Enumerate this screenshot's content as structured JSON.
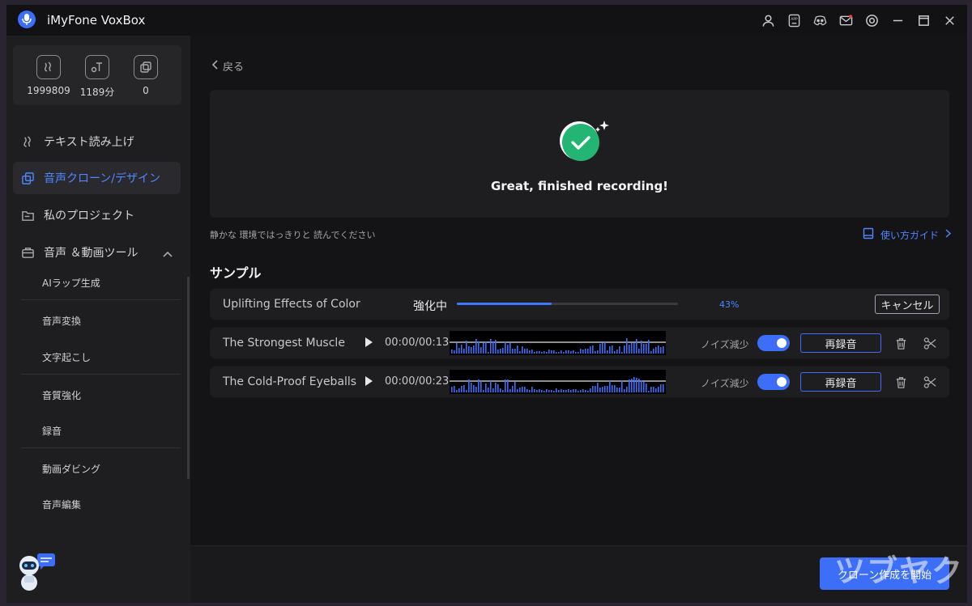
{
  "app": {
    "title": "iMyFone VoxBox"
  },
  "titlebar_icons": [
    "user-icon",
    "app-icon",
    "discord-icon",
    "mail-icon",
    "settings-icon",
    "minimize-icon",
    "maximize-icon",
    "close-icon"
  ],
  "titlebar": {
    "app_badge": "APP"
  },
  "stats": [
    {
      "icon": "voice-icon",
      "value": "1999809"
    },
    {
      "icon": "text-voice-icon",
      "value": "1189分"
    },
    {
      "icon": "clone-icon",
      "value": "0"
    }
  ],
  "sidebar": {
    "items": [
      {
        "label": "テキスト読み上げ",
        "icon": "voice-icon"
      },
      {
        "label": "音声クローン/デザイン",
        "icon": "clone-icon",
        "active": true
      },
      {
        "label": "私のプロジェクト",
        "icon": "folder-icon"
      },
      {
        "label": "音声 ＆動画ツール",
        "icon": "toolbox-icon"
      }
    ],
    "sub_items": [
      "AIラップ生成",
      "音声変換",
      "文字起こし",
      "音質強化",
      "録音",
      "動画ダビング",
      "音声編集"
    ]
  },
  "main": {
    "back_label": "戻る",
    "finish_text": "Great, finished recording!",
    "hint": "静かな 環境ではっきりと 読んでください",
    "guide_label": "使い方ガイド",
    "section_title": "サンプル",
    "enhancing": {
      "name": "Uplifting Effects of Color",
      "status": "強化中",
      "progress": 43,
      "progress_label": "43%",
      "cancel_label": "キャンセル"
    },
    "samples": [
      {
        "name": "The Strongest Muscle",
        "time": "00:00/00:13",
        "noise_label": "ノイズ減少",
        "noise_on": true,
        "rerecord_label": "再録音"
      },
      {
        "name": "The Cold-Proof Eyeballs",
        "time": "00:00/00:23",
        "noise_label": "ノイズ減少",
        "noise_on": true,
        "rerecord_label": "再録音"
      }
    ],
    "start_label": "クローン作成を開始",
    "watermark": "ツブヤク"
  },
  "colors": {
    "accent": "#3d6ef7",
    "bg": "#141416",
    "sidebar": "#1e1e21",
    "success": "#22b573"
  }
}
